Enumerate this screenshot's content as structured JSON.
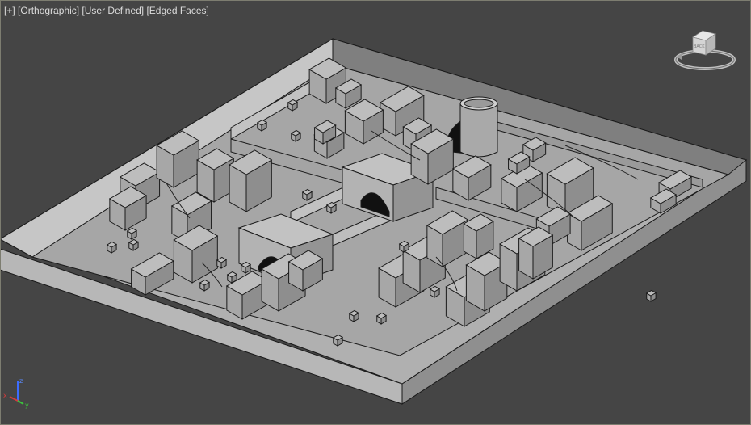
{
  "viewport": {
    "label_parts": [
      "[+]",
      "[Orthographic]",
      "[User Defined]",
      "[Edged Faces]"
    ],
    "background_color": "#454545",
    "border_color": "#7d7d70"
  },
  "viewcube": {
    "face_label": "BACK",
    "icon": "viewcube-icon"
  },
  "axis_tripod": {
    "x": "x",
    "y": "y",
    "z": "z",
    "colors": {
      "x": "#d23c3c",
      "y": "#3cc23c",
      "z": "#3c6cff"
    }
  },
  "scene": {
    "description_icon": "city-model-icon",
    "colors": {
      "base_top": "#a3a3a3",
      "wall_light": "#c9c9c9",
      "wall_dark": "#858585",
      "box_top": "#bdbdbd",
      "box_left": "#a7a7a7",
      "box_right": "#8e8e8e",
      "edge": "#1a1a1a"
    }
  }
}
